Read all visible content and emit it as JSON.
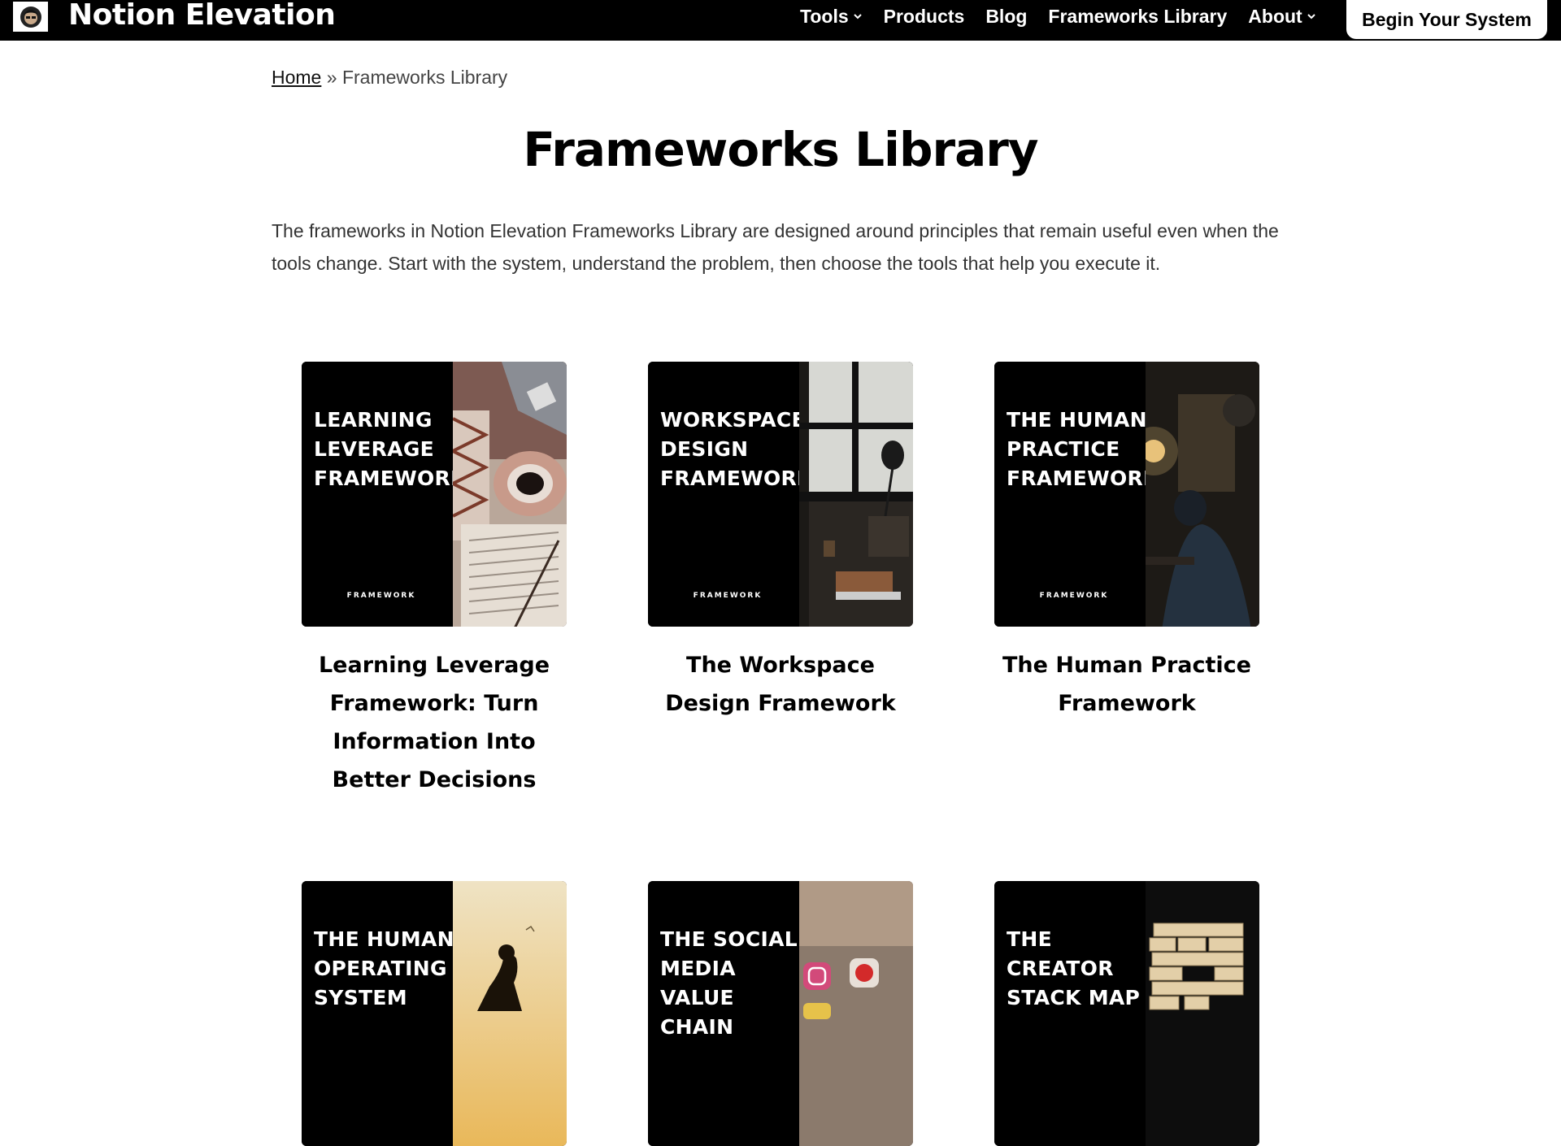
{
  "header": {
    "brand": "Notion Elevation",
    "logo_icon": "avatar-icon",
    "nav": [
      {
        "label": "Tools",
        "has_dropdown": true
      },
      {
        "label": "Products",
        "has_dropdown": false
      },
      {
        "label": "Blog",
        "has_dropdown": false
      },
      {
        "label": "Frameworks Library",
        "has_dropdown": false
      },
      {
        "label": "About",
        "has_dropdown": true
      }
    ],
    "cta_label": "Begin Your System"
  },
  "breadcrumb": {
    "home": "Home",
    "separator": "»",
    "current": "Frameworks Library"
  },
  "page": {
    "title": "Frameworks Library",
    "intro": "The frameworks in Notion Elevation Frameworks Library are designed around principles that remain useful even when the tools change. Start with the system, understand the problem, then choose the tools that help you execute it."
  },
  "cards": [
    {
      "thumb_title": "LEARNING LEVERAGE FRAMEWORK",
      "thumb_tag": "FRAMEWORK",
      "title": "Learning Leverage Framework: Turn Information Into Better Decisions"
    },
    {
      "thumb_title": "WORKSPACE DESIGN FRAMEWORK",
      "thumb_tag": "FRAMEWORK",
      "title": "The Workspace Design Framework"
    },
    {
      "thumb_title": "THE HUMAN PRACTICE FRAMEWORK",
      "thumb_tag": "FRAMEWORK",
      "title": "The Human Practice Framework"
    },
    {
      "thumb_title": "THE HUMAN OPERATING SYSTEM",
      "thumb_tag": "",
      "title": ""
    },
    {
      "thumb_title": "THE SOCIAL MEDIA VALUE CHAIN",
      "thumb_tag": "",
      "title": ""
    },
    {
      "thumb_title": "THE CREATOR STACK MAP",
      "thumb_tag": "",
      "title": ""
    }
  ],
  "colors": {
    "header_bg": "#000000",
    "page_bg": "#ffffff",
    "text": "#111111"
  }
}
